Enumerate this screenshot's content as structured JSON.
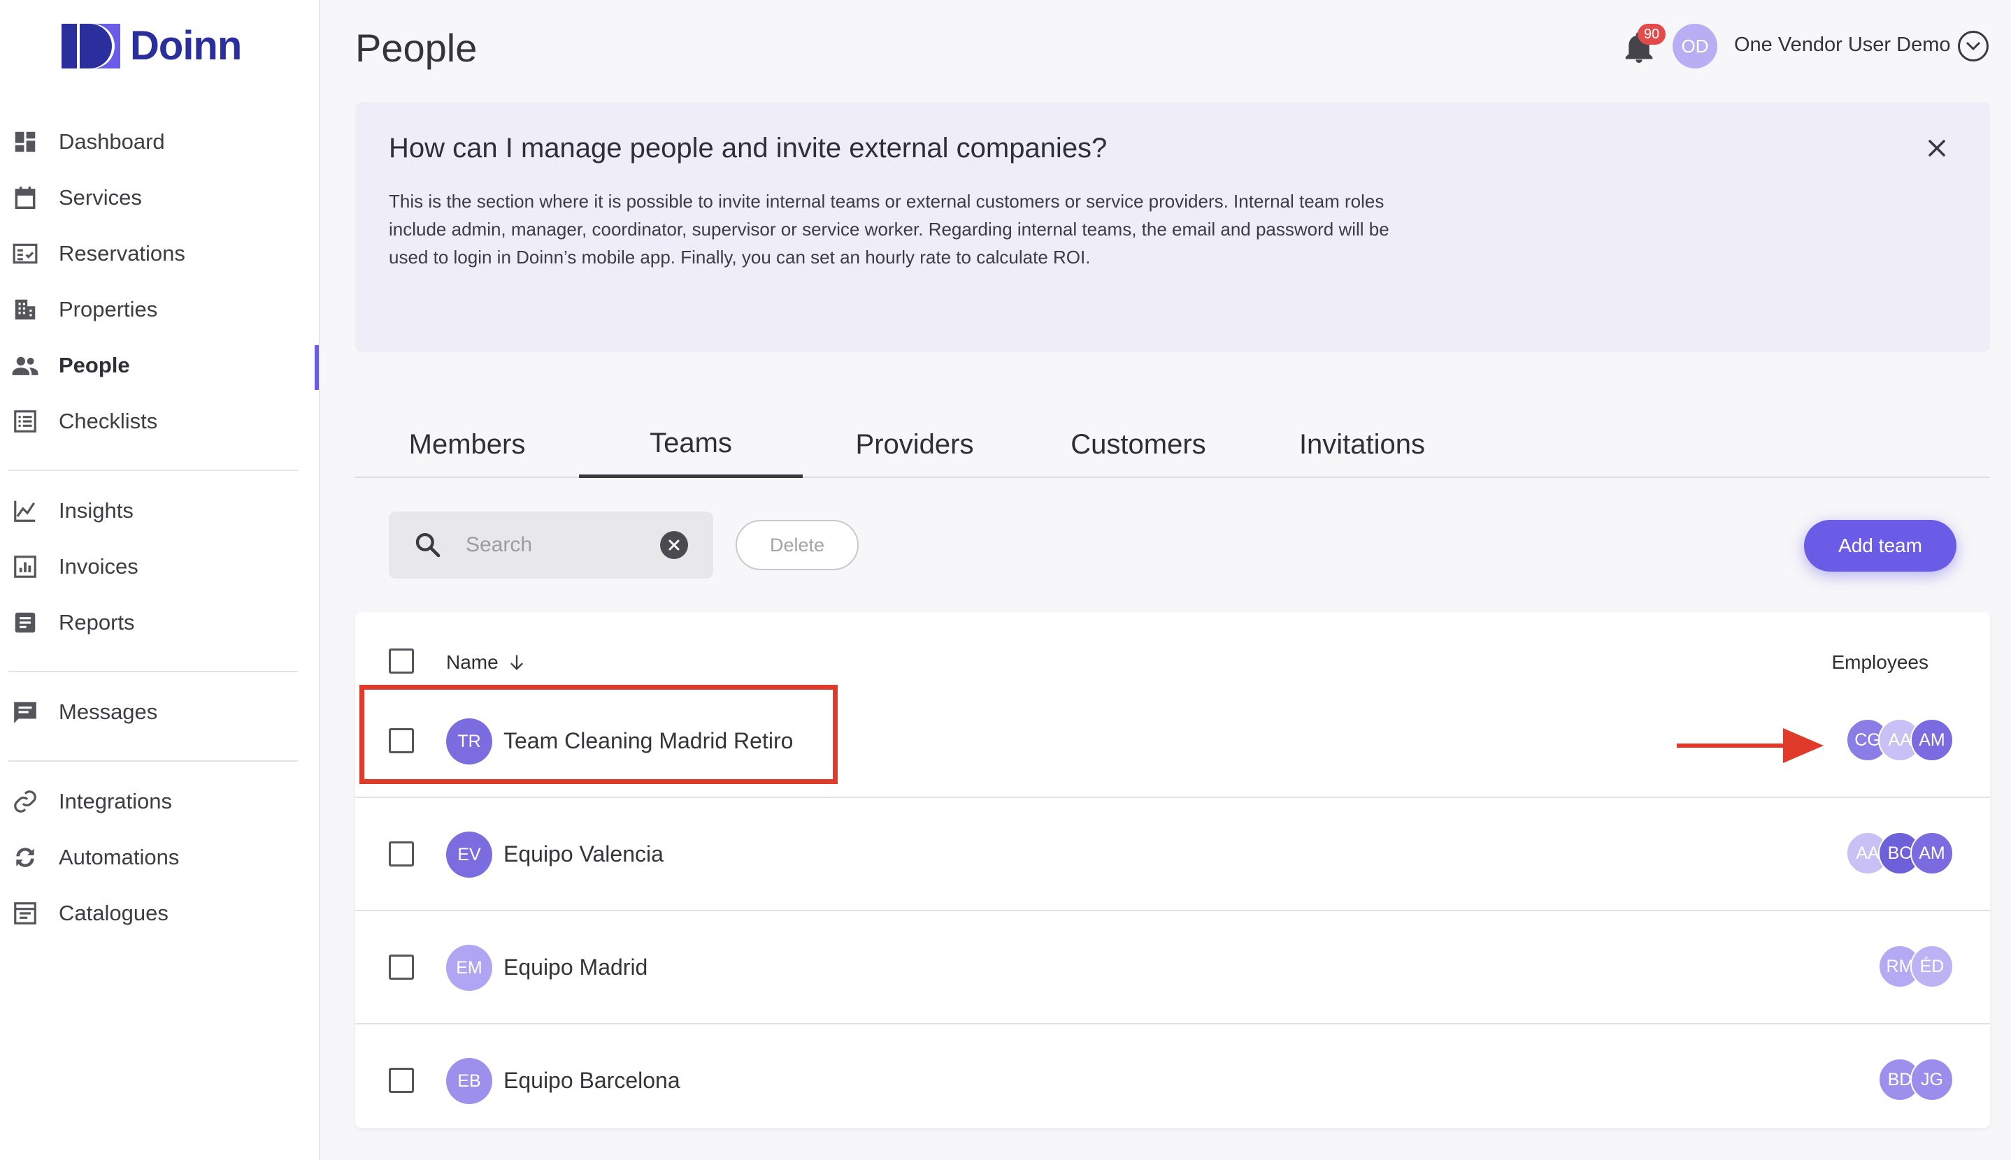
{
  "brand": {
    "name": "Doinn"
  },
  "sidebar": {
    "groups": [
      [
        {
          "label": "Dashboard",
          "icon": "dashboard-icon"
        },
        {
          "label": "Services",
          "icon": "calendar-icon"
        },
        {
          "label": "Reservations",
          "icon": "reservations-icon"
        },
        {
          "label": "Properties",
          "icon": "building-icon"
        },
        {
          "label": "People",
          "icon": "people-icon",
          "active": true
        },
        {
          "label": "Checklists",
          "icon": "checklist-icon"
        }
      ],
      [
        {
          "label": "Insights",
          "icon": "chart-icon"
        },
        {
          "label": "Invoices",
          "icon": "invoice-icon"
        },
        {
          "label": "Reports",
          "icon": "report-icon"
        }
      ],
      [
        {
          "label": "Messages",
          "icon": "message-icon"
        }
      ],
      [
        {
          "label": "Integrations",
          "icon": "link-icon"
        },
        {
          "label": "Automations",
          "icon": "sync-icon"
        },
        {
          "label": "Catalogues",
          "icon": "catalogue-icon"
        }
      ]
    ]
  },
  "header": {
    "title": "People",
    "notifications": "90",
    "user_initials": "OD",
    "user_name": "One Vendor User Demo"
  },
  "banner": {
    "title": "How can I manage people and invite external companies?",
    "text": "This is the section where it is possible to invite internal teams or external customers or service providers. Internal team roles include admin, manager, coordinator, supervisor or service worker. Regarding internal teams, the email and password will be used to login in Doinn’s mobile app. Finally, you can set an hourly rate to calculate ROI."
  },
  "tabs": [
    {
      "label": "Members"
    },
    {
      "label": "Teams",
      "active": true
    },
    {
      "label": "Providers"
    },
    {
      "label": "Customers"
    },
    {
      "label": "Invitations"
    }
  ],
  "toolbar": {
    "search_placeholder": "Search",
    "search_value": "",
    "delete_label": "Delete",
    "add_label": "Add team"
  },
  "table": {
    "col_name": "Name",
    "col_employees": "Employees",
    "rows": [
      {
        "initials": "TR",
        "name": "Team Cleaning Madrid Retiro",
        "color": "#7b6de0",
        "employees": [
          {
            "i": "CG",
            "c": "#8a7ee6"
          },
          {
            "i": "AA",
            "c": "#c9c1f5"
          },
          {
            "i": "AM",
            "c": "#7a6ce0"
          }
        ]
      },
      {
        "initials": "EV",
        "name": "Equipo Valencia",
        "color": "#7b6de0",
        "employees": [
          {
            "i": "AA",
            "c": "#c9c1f5"
          },
          {
            "i": "BC",
            "c": "#6e60d8"
          },
          {
            "i": "AM",
            "c": "#7a6ce0"
          }
        ]
      },
      {
        "initials": "EM",
        "name": "Equipo Madrid",
        "color": "#b0a5f2",
        "employees": [
          {
            "i": "RM",
            "c": "#b4a9f3"
          },
          {
            "i": "ÉD",
            "c": "#bdb3f4"
          }
        ]
      },
      {
        "initials": "EB",
        "name": "Equipo Barcelona",
        "color": "#9d90ec",
        "employees": [
          {
            "i": "BD",
            "c": "#9d90ec"
          },
          {
            "i": "JG",
            "c": "#9a8deb"
          }
        ]
      }
    ]
  },
  "colors": {
    "accent": "#6b5ce7",
    "annotation": "#e03a2a"
  }
}
